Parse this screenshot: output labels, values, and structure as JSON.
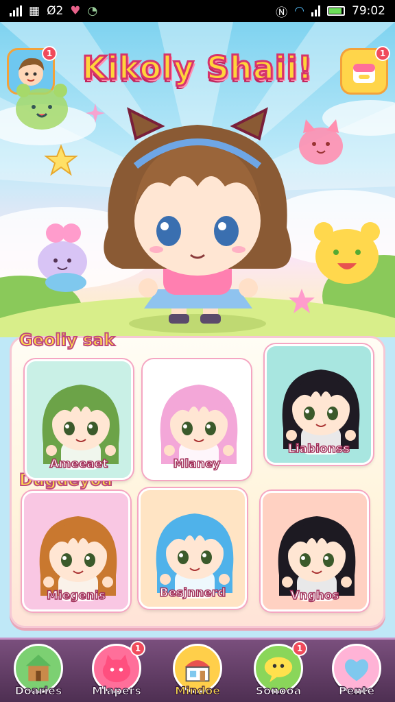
{
  "status_bar": {
    "left_text": "Ø2",
    "time": "79:02"
  },
  "header": {
    "title": "Kikoly Shaii!",
    "avatar_badge": "1",
    "shop_badge": "1"
  },
  "sections": [
    {
      "title": "Geoliy sak",
      "cards": [
        {
          "label": "Ameeaet",
          "hair": "#6ca348",
          "bg": "#c9f0e6"
        },
        {
          "label": "Mlaney",
          "hair": "#f3a7d8",
          "bg": "#ffffff"
        },
        {
          "label": "Liabionss",
          "hair": "#1f1b24",
          "bg": "#a8e6e0"
        }
      ]
    },
    {
      "title": "Dugdeyoa",
      "cards": [
        {
          "label": "Miegenis",
          "hair": "#c9782f",
          "bg": "#f9c7e3"
        },
        {
          "label": "Besjnnerd",
          "hair": "#4fb2ea",
          "bg": "#ffe4c4"
        },
        {
          "label": "Vnghos",
          "hair": "#1d1a22",
          "bg": "#ffd1c2"
        }
      ]
    }
  ],
  "bottom_nav": [
    {
      "label": "Doaries",
      "icon": "house-icon",
      "color": "#7cd072",
      "badge": ""
    },
    {
      "label": "Mlapers",
      "icon": "pink-creature-icon",
      "color": "#ff6f9a",
      "badge": "1"
    },
    {
      "label": "Mindoe",
      "icon": "shop-icon",
      "color": "#ffcf4a",
      "badge": ""
    },
    {
      "label": "Sonooa",
      "icon": "chat-bubble-icon",
      "color": "#8ad65a",
      "badge": "1"
    },
    {
      "label": "Pente",
      "icon": "heart-icon",
      "color": "#ffb3d6",
      "badge": ""
    }
  ]
}
